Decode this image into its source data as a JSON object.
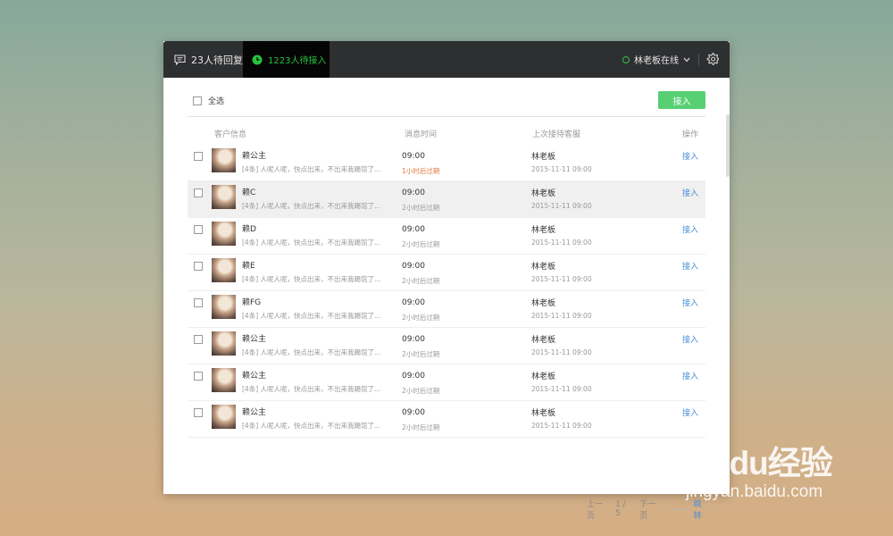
{
  "header": {
    "tab_replies": "23人待回复",
    "tab_waiting": "1223人待接入",
    "status": "林老板在线"
  },
  "toolbar": {
    "select_all": "全选",
    "accept": "接入"
  },
  "columns": {
    "customer": "客户信息",
    "msg_time": "消息时间",
    "last_agent": "上次接待客服",
    "action": "操作"
  },
  "rows": [
    {
      "name": "赖公主",
      "message": "[4条] 人呢人呢，快点出来，不出来我踢馆了...",
      "time": "09:00",
      "expire": "1小时后过期",
      "agent": "林老板",
      "date": "2015-11-11 09:00",
      "action": "接入"
    },
    {
      "name": "赖C",
      "message": "[4条] 人呢人呢，快点出来，不出来我踢馆了...",
      "time": "09:00",
      "expire": "2小时后过期",
      "agent": "林老板",
      "date": "2015-11-11 09:00",
      "action": "接入"
    },
    {
      "name": "赖D",
      "message": "[4条] 人呢人呢，快点出来，不出来我踢馆了...",
      "time": "09:00",
      "expire": "2小时后过期",
      "agent": "林老板",
      "date": "2015-11-11 09:00",
      "action": "接入"
    },
    {
      "name": "赖E",
      "message": "[4条] 人呢人呢，快点出来，不出来我踢馆了...",
      "time": "09:00",
      "expire": "2小时后过期",
      "agent": "林老板",
      "date": "2015-11-11 09:00",
      "action": "接入"
    },
    {
      "name": "赖FG",
      "message": "[4条] 人呢人呢，快点出来，不出来我踢馆了...",
      "time": "09:00",
      "expire": "2小时后过期",
      "agent": "林老板",
      "date": "2015-11-11 09:00",
      "action": "接入"
    },
    {
      "name": "赖公主",
      "message": "[4条] 人呢人呢，快点出来，不出来我踢馆了...",
      "time": "09:00",
      "expire": "2小时后过期",
      "agent": "林老板",
      "date": "2015-11-11 09:00",
      "action": "接入"
    },
    {
      "name": "赖公主",
      "message": "[4条] 人呢人呢，快点出来，不出来我踢馆了...",
      "time": "09:00",
      "expire": "2小时后过期",
      "agent": "林老板",
      "date": "2015-11-11 09:00",
      "action": "接入"
    },
    {
      "name": "赖公主",
      "message": "[4条] 人呢人呢，快点出来，不出来我踢馆了...",
      "time": "09:00",
      "expire": "2小时后过期",
      "agent": "林老板",
      "date": "2015-11-11 09:00",
      "action": "接入"
    }
  ],
  "pagination": {
    "prev": "上一页",
    "page": "1 / 5",
    "next": "下一页",
    "jump": "跳转"
  },
  "watermark": {
    "main": "Baidu经验",
    "sub": "jingyan.baidu.com"
  },
  "colors": {
    "accent_green": "#59cf74",
    "online_green": "#2fbf45",
    "link_blue": "#4a8fd6",
    "expire_warn": "#e07a3a"
  }
}
